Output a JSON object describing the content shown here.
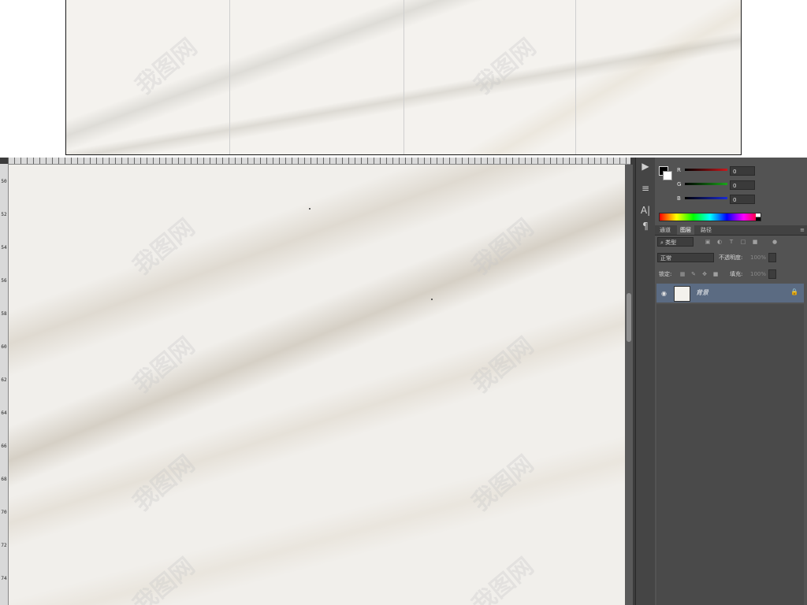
{
  "watermark": {
    "text": "我图网"
  },
  "ruler": {
    "left_ticks": [
      "50",
      "52",
      "54",
      "56",
      "58",
      "60",
      "62",
      "64",
      "66",
      "68",
      "70",
      "72",
      "74"
    ]
  },
  "color_panel": {
    "channels": [
      {
        "label": "R",
        "value": "0",
        "color": "#c8191d"
      },
      {
        "label": "G",
        "value": "0",
        "color": "#1aa51a"
      },
      {
        "label": "B",
        "value": "0",
        "color": "#1a2bd6"
      }
    ]
  },
  "layers_panel": {
    "tabs": [
      "通道",
      "图层",
      "路径"
    ],
    "active_tab": 1,
    "filter_kind": "类型",
    "blend_mode": "正常",
    "opacity_label": "不透明度:",
    "opacity_value": "100%",
    "lock_label": "锁定:",
    "fill_label": "填充:",
    "fill_value": "100%",
    "layers": [
      {
        "name": "背景"
      }
    ]
  }
}
